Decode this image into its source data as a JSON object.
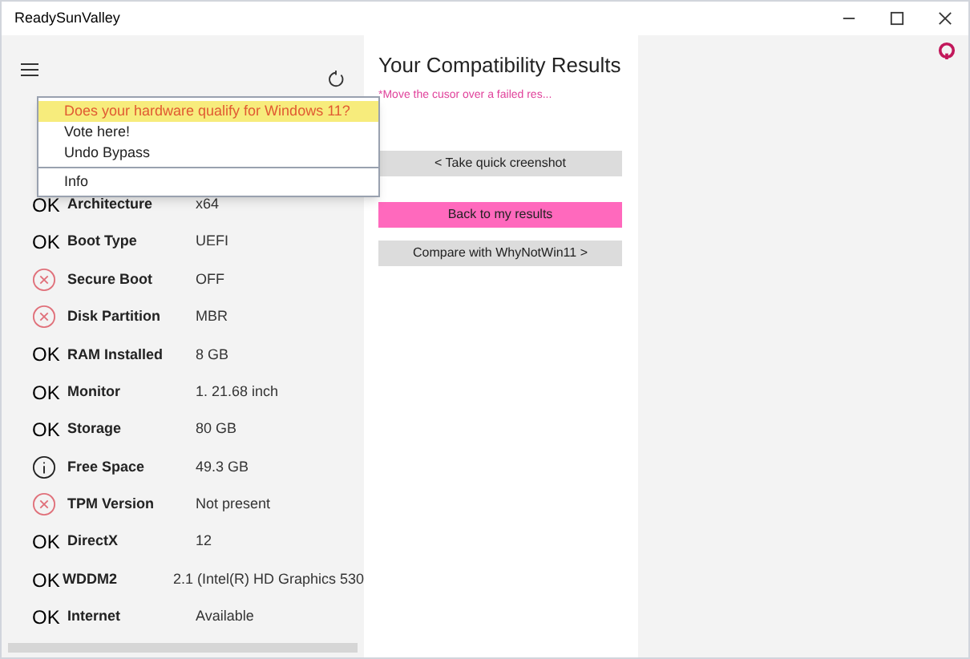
{
  "window": {
    "title": "ReadySunValley"
  },
  "menu": {
    "items": [
      {
        "label": "Does your hardware qualify for Windows 11?",
        "selected": true,
        "divider_before": false
      },
      {
        "label": "Vote here!",
        "selected": false,
        "divider_before": false
      },
      {
        "label": "Undo Bypass",
        "selected": false,
        "divider_before": false
      },
      {
        "label": "Info",
        "selected": false,
        "divider_before": true
      }
    ]
  },
  "checks": [
    {
      "kind": "ok",
      "mark": "OK",
      "label": "Architecture",
      "value": "x64"
    },
    {
      "kind": "ok",
      "mark": "OK",
      "label": "Boot Type",
      "value": "UEFI"
    },
    {
      "kind": "fail",
      "label": "Secure Boot",
      "value": "OFF"
    },
    {
      "kind": "fail",
      "label": "Disk Partition",
      "value": "MBR"
    },
    {
      "kind": "ok",
      "mark": "OK",
      "label": "RAM Installed",
      "value": "8 GB"
    },
    {
      "kind": "ok",
      "mark": "OK",
      "label": "Monitor",
      "value": "1. 21.68 inch"
    },
    {
      "kind": "ok",
      "mark": "OK",
      "label": "Storage",
      "value": "80 GB"
    },
    {
      "kind": "info",
      "label": "Free Space",
      "value": "49.3 GB"
    },
    {
      "kind": "fail",
      "label": "TPM Version",
      "value": "Not present"
    },
    {
      "kind": "ok",
      "mark": "OK",
      "label": "DirectX",
      "value": "12"
    },
    {
      "kind": "ok",
      "mark": "OK",
      "label": "WDDM2",
      "value": "2.1 (Intel(R) HD Graphics 530"
    },
    {
      "kind": "ok",
      "mark": "OK",
      "label": "Internet",
      "value": "Available"
    }
  ],
  "results": {
    "title": "Your Compatibility Results",
    "hint": "*Move the cusor over a failed res...",
    "buttons": [
      {
        "label": "< Take quick creenshot",
        "primary": false
      },
      {
        "label": "Back to my results",
        "primary": true
      },
      {
        "label": "Compare with WhyNotWin11 >",
        "primary": false
      }
    ]
  }
}
